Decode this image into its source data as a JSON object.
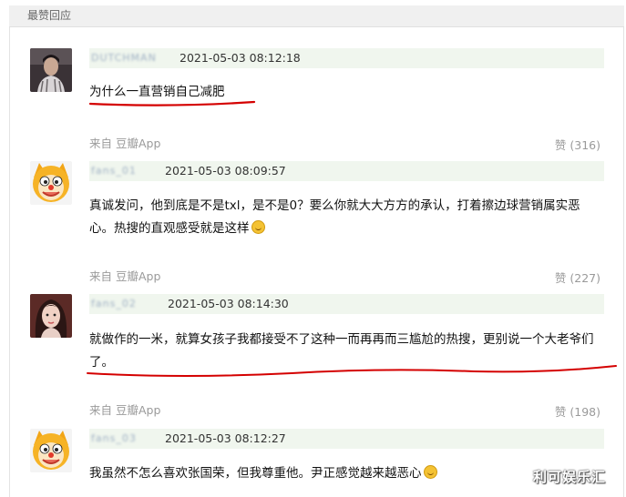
{
  "section": {
    "title": "最赞回应"
  },
  "comments": [
    {
      "username": "DUTCHMAN",
      "time": "2021-05-03 08:12:18",
      "text": "为什么一直营销自己减肥",
      "source": "",
      "likes": ""
    },
    {
      "username": "fans_01",
      "time": "2021-05-03 08:09:57",
      "text": "真诚发问，他到底是不是txl，是不是0？要么你就大大方方的承认，打着擦边球营销属实恶心。热搜的直观感受就是这样",
      "source": "来自 豆瓣App",
      "likes": "赞 (316)"
    },
    {
      "username": "fans_02",
      "time": "2021-05-03 08:14:30",
      "text": "就做作的一米，就算女孩子我都接受不了这种一而再再而三尴尬的热搜，更别说一个大老爷们了。",
      "source": "来自 豆瓣App",
      "likes": "赞 (227)"
    },
    {
      "username": "fans_03",
      "time": "2021-05-03 08:12:27",
      "text": "我虽然不怎么喜欢张国荣，但我尊重他。尹正感觉越来越恶心",
      "source": "来自 豆瓣App",
      "likes": "赞 (198)"
    }
  ],
  "footer": {
    "source": "来自 豆瓣App",
    "likes": "赞 (198)"
  },
  "icons": {
    "emoji_1": "upside-down-smile-emoji-icon",
    "emoji_2": "smile-emoji-icon"
  },
  "colors": {
    "annotation": "#d40000",
    "meta_bar": "#f0f6ee"
  },
  "watermark": "利可娱乐汇"
}
